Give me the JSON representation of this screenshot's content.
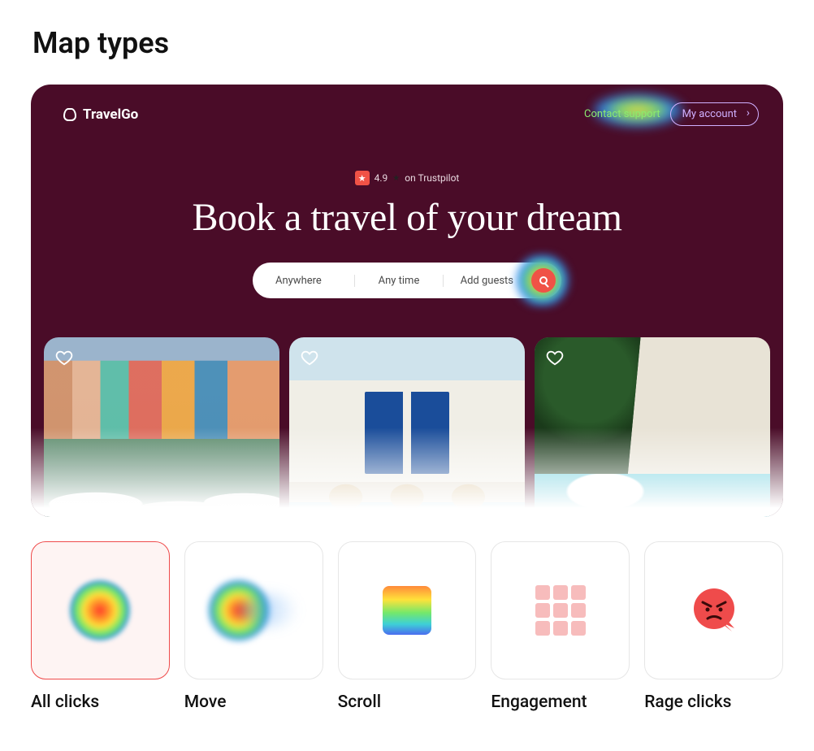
{
  "tab": {
    "label": "Map types"
  },
  "site": {
    "brand": "TravelGo",
    "header": {
      "contact": "Contact support",
      "account": "My account"
    },
    "rating": {
      "score": "4.9",
      "source": "on Trustpilot"
    },
    "hero_title": "Book a travel of your dream",
    "search": {
      "where": "Anywhere",
      "when": "Any time",
      "who": "Add guests"
    }
  },
  "map_types": [
    {
      "key": "all-clicks",
      "label": "All clicks",
      "active": true
    },
    {
      "key": "move",
      "label": "Move",
      "active": false
    },
    {
      "key": "scroll",
      "label": "Scroll",
      "active": false
    },
    {
      "key": "engagement",
      "label": "Engagement",
      "active": false
    },
    {
      "key": "rage",
      "label": "Rage clicks",
      "active": false
    }
  ],
  "colors": {
    "site_bg": "#4a0c28",
    "accent_red": "#ef4b4b"
  }
}
